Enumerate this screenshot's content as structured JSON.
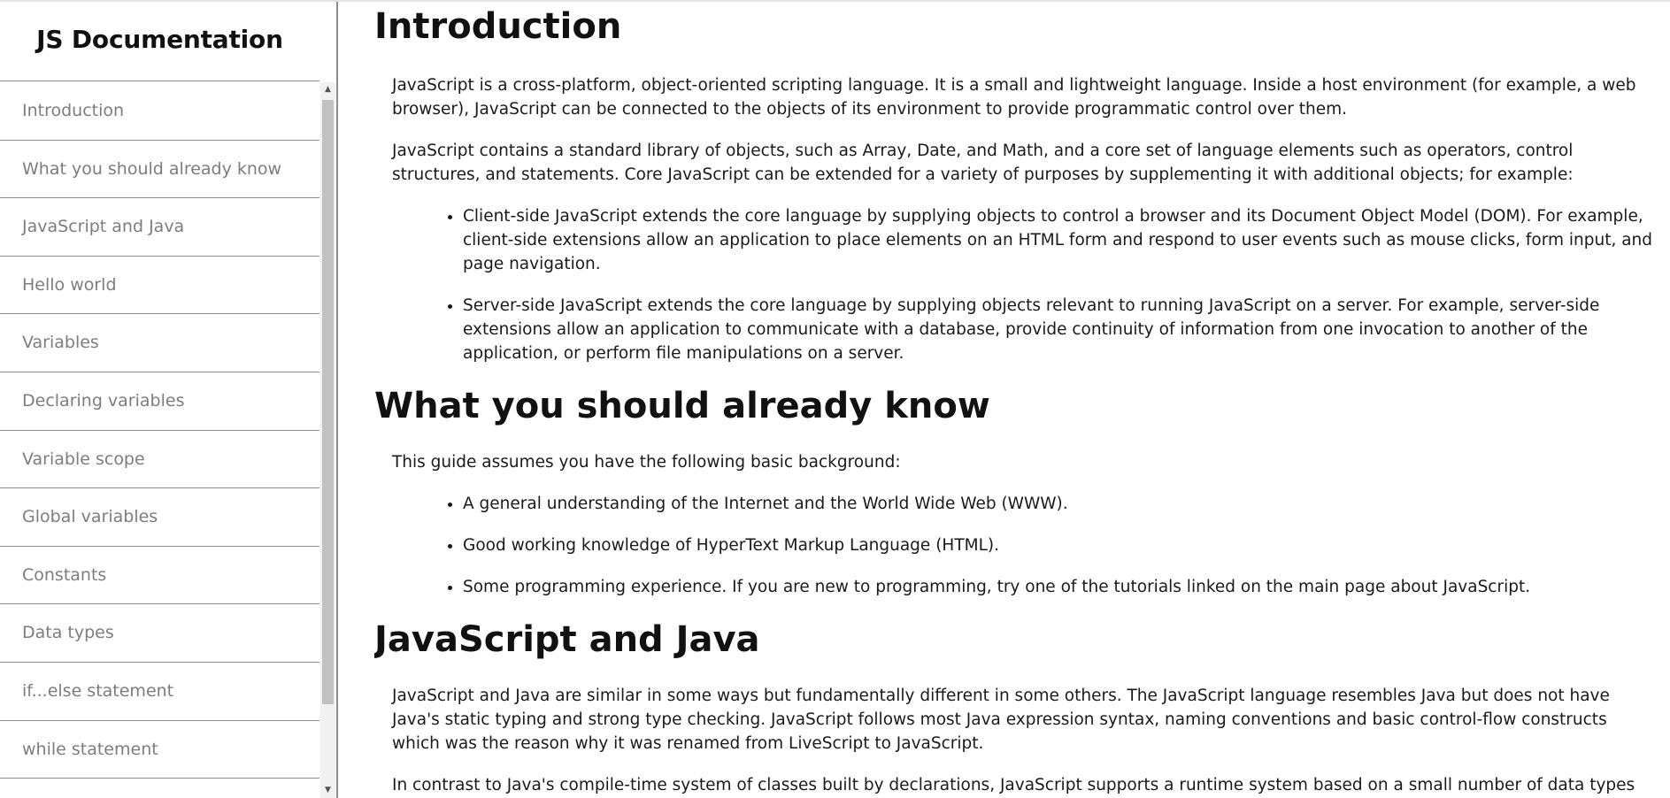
{
  "sidebar": {
    "title": "JS Documentation",
    "items": [
      {
        "label": "Introduction"
      },
      {
        "label": "What you should already know"
      },
      {
        "label": "JavaScript and Java"
      },
      {
        "label": "Hello world"
      },
      {
        "label": "Variables"
      },
      {
        "label": "Declaring variables"
      },
      {
        "label": "Variable scope"
      },
      {
        "label": "Global variables"
      },
      {
        "label": "Constants"
      },
      {
        "label": "Data types"
      },
      {
        "label": "if...else statement"
      },
      {
        "label": "while statement"
      }
    ]
  },
  "sections": {
    "introduction": {
      "title": "Introduction",
      "p1": "JavaScript is a cross-platform, object-oriented scripting language. It is a small and lightweight language. Inside a host environment (for example, a web browser), JavaScript can be connected to the objects of its environment to provide programmatic control over them.",
      "p2": "JavaScript contains a standard library of objects, such as Array, Date, and Math, and a core set of language elements such as operators, control structures, and statements. Core JavaScript can be extended for a variety of purposes by supplementing it with additional objects; for example:",
      "bullets": [
        "Client-side JavaScript extends the core language by supplying objects to control a browser and its Document Object Model (DOM). For example, client-side extensions allow an application to place elements on an HTML form and respond to user events such as mouse clicks, form input, and page navigation.",
        "Server-side JavaScript extends the core language by supplying objects relevant to running JavaScript on a server. For example, server-side extensions allow an application to communicate with a database, provide continuity of information from one invocation to another of the application, or perform file manipulations on a server."
      ]
    },
    "know": {
      "title": "What you should already know",
      "p1": "This guide assumes you have the following basic background:",
      "bullets": [
        "A general understanding of the Internet and the World Wide Web (WWW).",
        "Good working knowledge of HyperText Markup Language (HTML).",
        "Some programming experience. If you are new to programming, try one of the tutorials linked on the main page about JavaScript."
      ]
    },
    "java": {
      "title": "JavaScript and Java",
      "p1": "JavaScript and Java are similar in some ways but fundamentally different in some others. The JavaScript language resembles Java but does not have Java's static typing and strong type checking. JavaScript follows most Java expression syntax, naming conventions and basic control-flow constructs which was the reason why it was renamed from LiveScript to JavaScript.",
      "p2": "In contrast to Java's compile-time system of classes built by declarations, JavaScript supports a runtime system based on a small number of data types"
    }
  }
}
